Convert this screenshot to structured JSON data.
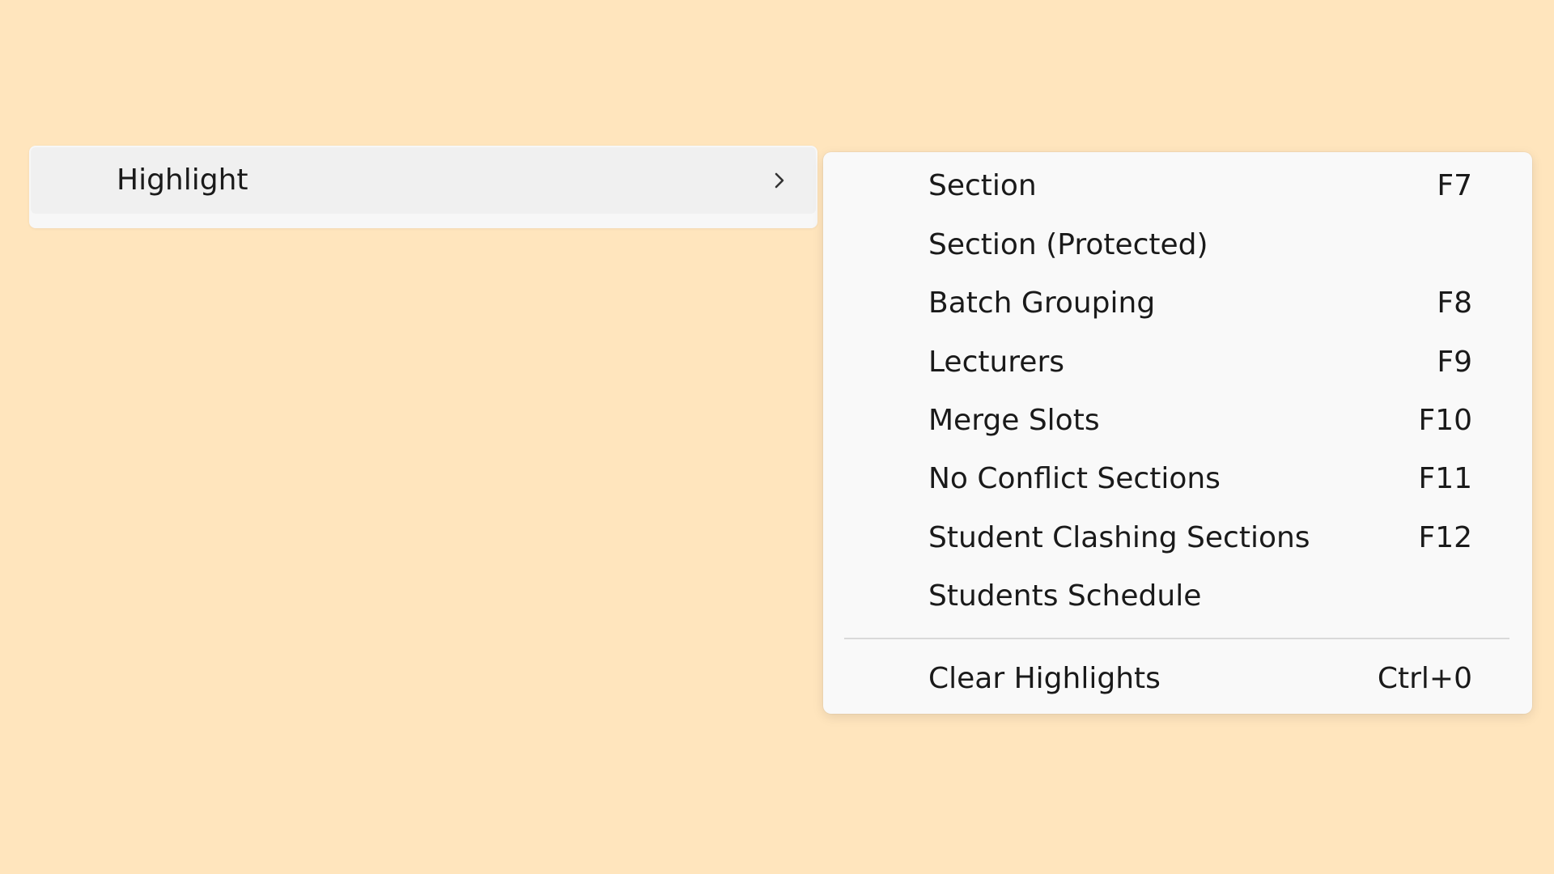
{
  "parent_menu": {
    "label": "Highlight",
    "submenu_indicator": "chevron-right-icon"
  },
  "submenu": {
    "items": [
      {
        "label": "Section",
        "shortcut": "F7"
      },
      {
        "label": "Section (Protected)",
        "shortcut": ""
      },
      {
        "label": "Batch Grouping",
        "shortcut": "F8"
      },
      {
        "label": "Lecturers",
        "shortcut": "F9"
      },
      {
        "label": "Merge Slots",
        "shortcut": "F10"
      },
      {
        "label": "No Conflict Sections",
        "shortcut": "F11"
      },
      {
        "label": "Student Clashing Sections",
        "shortcut": "F12"
      },
      {
        "label": "Students Schedule",
        "shortcut": ""
      }
    ],
    "footer_item": {
      "label": "Clear Highlights",
      "shortcut": "Ctrl+0"
    }
  },
  "colors": {
    "background": "#ffe5bd",
    "menu_background": "#f9f9f9",
    "hover_background": "#f0f0f0"
  }
}
